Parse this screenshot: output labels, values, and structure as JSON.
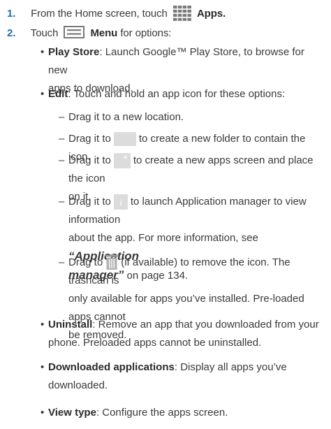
{
  "steps": [
    {
      "num": "1.",
      "pre": "From the Home screen, touch",
      "icon": "apps-grid-icon",
      "bold": "Apps."
    },
    {
      "num": "2.",
      "pre": "Touch",
      "icon": "menu-icon",
      "bold": "Menu",
      "post": "for options:"
    }
  ],
  "options": {
    "play_store": {
      "label": "Play Store",
      "text1": ": Launch Google™ Play Store, to browse for new",
      "text2": "apps to download."
    },
    "edit": {
      "label": "Edit",
      "text": ": Touch and hold an app icon for these options:"
    },
    "uninstall": {
      "label": "Uninstall",
      "text1": ": Remove an app that you downloaded from your",
      "text2": "phone. Preloaded apps cannot be uninstalled."
    },
    "downloaded": {
      "label": "Downloaded applications",
      "text1": ": Display all apps you’ve",
      "text2": "downloaded."
    },
    "view_type": {
      "label": "View type",
      "text": ": Configure the apps screen."
    }
  },
  "edit_subitems": {
    "new_location": "Drag it to a new location.",
    "folder": {
      "pre": "Drag it to",
      "icon": "create-folder-icon",
      "post": "to create a new folder to contain the icon."
    },
    "new_screen": {
      "pre": "Drag it to",
      "icon": "add-screen-icon",
      "post": "to create a new apps screen and place the icon",
      "post2": "on it."
    },
    "app_info": {
      "pre": "Drag it to",
      "icon": "app-info-icon",
      "post": "to launch Application manager to view information",
      "line2": "about the app. For more information, see",
      "ref": "“Application",
      "ref2": "manager”",
      "ref_post": "on page 134."
    },
    "remove": {
      "pre": "Drag to",
      "icon": "trashcan-icon",
      "post": "(if available) to remove the icon. The trashcan is",
      "line2": "only available for apps you’ve installed. Pre-loaded apps cannot",
      "line3": "be removed."
    }
  },
  "colors": {
    "accent": "#1d6fb0",
    "icon_bg": "#dcdcdc",
    "text": "#3a3a3a"
  }
}
